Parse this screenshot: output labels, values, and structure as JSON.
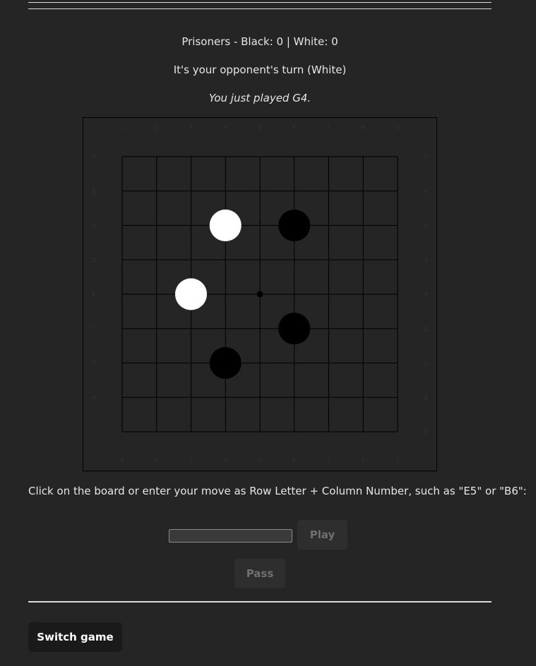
{
  "status": {
    "prisoners": "Prisoners - Black: 0 | White: 0",
    "turn": "It's your opponent's turn (White)",
    "last_move": "You just played G4."
  },
  "board": {
    "size": 9,
    "top_labels": [
      "1",
      "2",
      "3",
      "4",
      "5",
      "6",
      "7",
      "8",
      "9"
    ],
    "bottom_labels": [
      "9",
      "8",
      "7",
      "6",
      "5",
      "4",
      "3",
      "2",
      "1"
    ],
    "left_labels": [
      "A",
      "B",
      "C",
      "D",
      "E",
      "F",
      "G",
      "H",
      "I"
    ],
    "right_labels": [
      "I",
      "H",
      "G",
      "F",
      "E",
      "D",
      "C",
      "B",
      "A"
    ],
    "hoshi": [
      {
        "row": 4,
        "col": 4
      }
    ],
    "stones": [
      {
        "row": 2,
        "col": 3,
        "color": "white"
      },
      {
        "row": 2,
        "col": 5,
        "color": "black"
      },
      {
        "row": 4,
        "col": 2,
        "color": "white"
      },
      {
        "row": 5,
        "col": 5,
        "color": "black"
      },
      {
        "row": 6,
        "col": 3,
        "color": "black"
      }
    ],
    "colors": {
      "line": "#000000",
      "frame": "#000000",
      "label": "#333333",
      "white_stone": "#ffffff",
      "black_stone": "#000000"
    }
  },
  "instructions": "Click on the board or enter your move as Row Letter + Column Number, such as \"E5\" or \"B6\":",
  "controls": {
    "move_value": "",
    "play_label": "Play",
    "pass_label": "Pass",
    "switch_label": "Switch game"
  },
  "theme": {
    "background": "#252525",
    "text": "#e6e6e6"
  }
}
